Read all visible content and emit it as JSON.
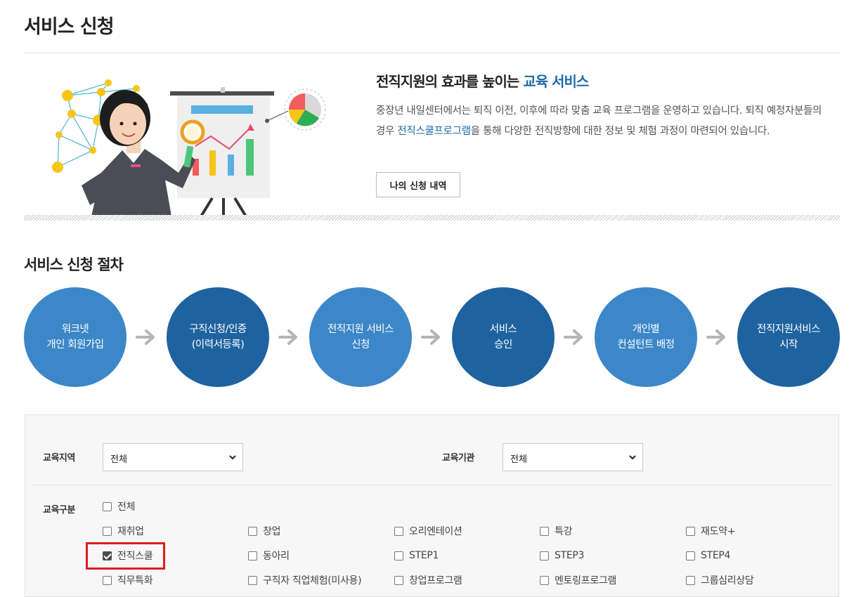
{
  "page": {
    "title": "서비스 신청"
  },
  "hero": {
    "heading_prefix": "전직지원의 효과를 높이는 ",
    "heading_accent": "교육 서비스",
    "desc_part1": "중장년 내일센터에서는 퇴직 이전, 이후에 따라 맞춤 교육 프로그램을 운영하고 있습니다. 퇴직 예정자분들의 경우 ",
    "desc_link": "전직스쿨프로그램",
    "desc_part2": "을 통해 다양한 전직방향에 대한 정보 및 체험 과정이 마련되어 있습니다.",
    "history_button": "나의 신청 내역"
  },
  "procedure": {
    "title": "서비스 신청 절차",
    "steps": [
      {
        "label": "워크넷\n개인 회원가입"
      },
      {
        "label": "구직신청/인증\n(이력서등록)"
      },
      {
        "label": "전직지원 서비스\n신청"
      },
      {
        "label": "서비스\n승인"
      },
      {
        "label": "개인별\n컨설턴트 배정"
      },
      {
        "label": "전직지원서비스\n시작"
      }
    ]
  },
  "filters": {
    "region_label": "교육지역",
    "region_value": "전체",
    "institution_label": "교육기관",
    "institution_value": "전체",
    "category_label": "교육구분",
    "categories": [
      {
        "label": "전체",
        "checked": false
      },
      {
        "label": "재취업",
        "checked": false
      },
      {
        "label": "창업",
        "checked": false
      },
      {
        "label": "오리엔테이션",
        "checked": false
      },
      {
        "label": "특강",
        "checked": false
      },
      {
        "label": "재도약+",
        "checked": false
      },
      {
        "label": "전직스쿨",
        "checked": true
      },
      {
        "label": "동아리",
        "checked": false
      },
      {
        "label": "STEP1",
        "checked": false
      },
      {
        "label": "STEP3",
        "checked": false
      },
      {
        "label": "STEP4",
        "checked": false
      },
      {
        "label": "직무특화",
        "checked": false
      },
      {
        "label": "구직자 직업체험(미사용)",
        "checked": false
      },
      {
        "label": "창업프로그램",
        "checked": false
      },
      {
        "label": "멘토링프로그램",
        "checked": false
      },
      {
        "label": "그룹심리상담",
        "checked": false
      }
    ]
  },
  "colors": {
    "accent": "#1f6aa8",
    "step_light": "#3c87c8",
    "step_dark": "#1f62a0",
    "highlight": "#e01b1b",
    "arrow": "#b5b5b5"
  }
}
